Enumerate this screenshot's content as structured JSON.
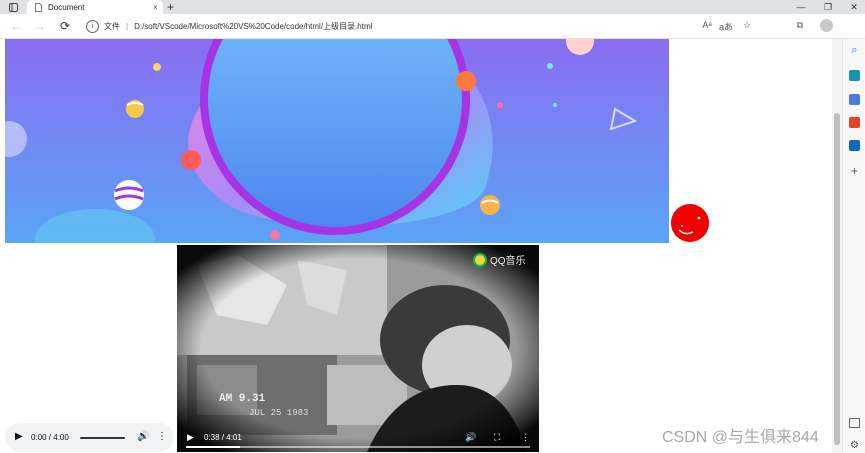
{
  "browser": {
    "tab_title": "Document",
    "tab_close": "×",
    "new_tab": "+",
    "window_minimize": "—",
    "window_restore": "❐",
    "window_close": "✕"
  },
  "toolbar": {
    "back": "←",
    "forward": "→",
    "reload": "⟳",
    "info_icon": "i",
    "address_label": "文件",
    "address_separator": "|",
    "address_url": "D:/soft/VScode/Microsoft%20VS%20Code/code/html/上级目录.html",
    "read_aloud": "Aᵃ",
    "immersive": "aあ",
    "favorite": "☆",
    "collections": "⧉"
  },
  "video": {
    "logo_text": "QQ音乐",
    "overlay_date": "AM 9.31",
    "overlay_date2": "JUL 25 1983",
    "time": "0:38 / 4:01",
    "progress": 0.158,
    "play_icon": "▶",
    "volume_icon": "🔊",
    "fullscreen_icon": "⛶",
    "more_icon": "⋮"
  },
  "audio": {
    "play_icon": "▶",
    "time": "0:00 / 4:00",
    "volume_icon": "🔊",
    "more_icon": "⋮"
  },
  "watermark": "CSDN @与生俱来844",
  "sidebar": {
    "search_icon": "⌕",
    "add": "+"
  },
  "colors": {
    "banner_top": "#8a6df0",
    "banner_bottom": "#5aa4f6",
    "circle_ring": "#a634e6",
    "float_ball": "#f00000",
    "audio_bg": "#f1f3f4"
  }
}
